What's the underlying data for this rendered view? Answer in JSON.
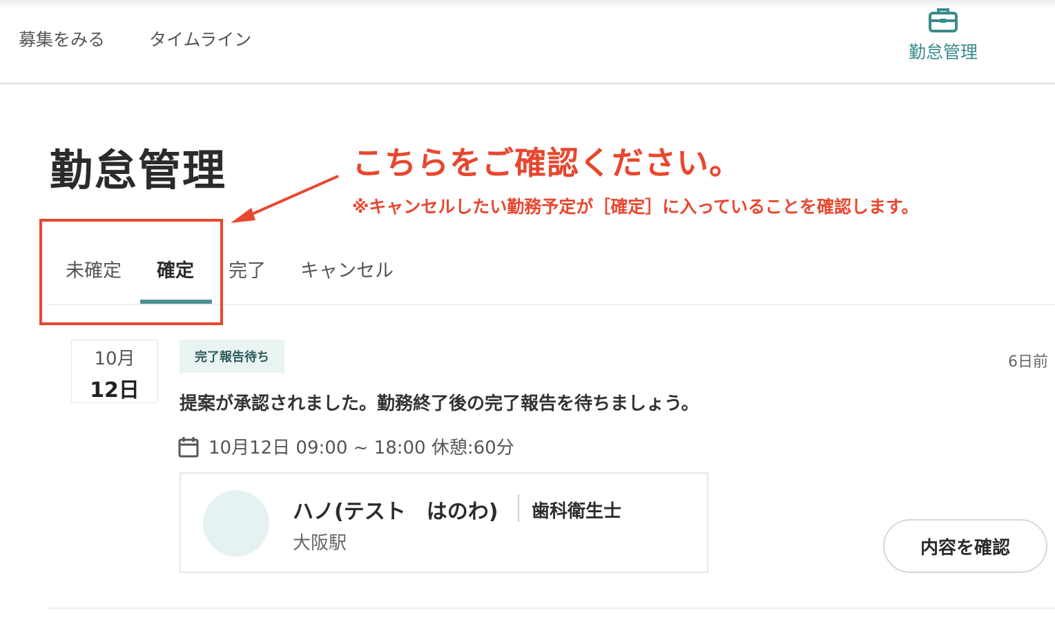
{
  "header": {
    "nav_recruit": "募集をみる",
    "nav_timeline": "タイムライン",
    "nav_attendance": "勤怠管理",
    "attendance_icon": "briefcase-icon"
  },
  "page": {
    "title": "勤怠管理"
  },
  "annotation": {
    "main": "こちらをご確認ください。",
    "sub": "※キャンセルしたい勤務予定が［確定］に入っていることを確認します。",
    "color": "#e8472f"
  },
  "tabs": [
    {
      "label": "未確定",
      "active": false
    },
    {
      "label": "確定",
      "active": true
    },
    {
      "label": "完了",
      "active": false
    },
    {
      "label": "キャンセル",
      "active": false
    }
  ],
  "item": {
    "month": "10月",
    "day": "12日",
    "status": "完了報告待ち",
    "age": "6日前",
    "message": "提案が承認されました。勤務終了後の完了報告を待ちましょう。",
    "schedule_icon": "calendar-icon",
    "schedule": "10月12日 09:00 ~ 18:00 休憩:60分",
    "worker": {
      "name": "ハノ(テスト　はのわ)",
      "role": "歯科衛生士",
      "station": "大阪駅"
    },
    "confirm_button": "内容を確認"
  },
  "colors": {
    "accent": "#4e8f91",
    "badge_bg": "#e9f3f2"
  }
}
